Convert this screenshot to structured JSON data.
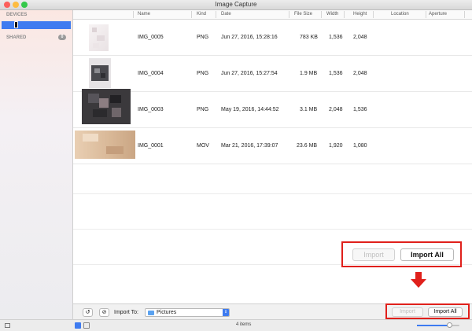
{
  "window": {
    "title": "Image Capture"
  },
  "sidebar": {
    "devices_label": "DEVICES",
    "shared_label": "SHARED",
    "shared_count": "0"
  },
  "columns": [
    "Name",
    "Kind",
    "Date",
    "File Size",
    "Width",
    "Height",
    "Location",
    "Aperture"
  ],
  "files": [
    {
      "name": "IMG_0005",
      "kind": "PNG",
      "date": "Jun 27, 2016, 15:28:16",
      "size": "783 KB",
      "width": "1,536",
      "height": "2,048"
    },
    {
      "name": "IMG_0004",
      "kind": "PNG",
      "date": "Jun 27, 2016, 15:27:54",
      "size": "1.9 MB",
      "width": "1,536",
      "height": "2,048"
    },
    {
      "name": "IMG_0003",
      "kind": "PNG",
      "date": "May 19, 2016, 14:44:52",
      "size": "3.1 MB",
      "width": "2,048",
      "height": "1,536"
    },
    {
      "name": "IMG_0001",
      "kind": "MOV",
      "date": "Mar 21, 2016, 17:39:07",
      "size": "23.6 MB",
      "width": "1,920",
      "height": "1,080"
    }
  ],
  "callout": {
    "import_label": "Import",
    "import_all_label": "Import All"
  },
  "bottom": {
    "import_to_label": "Import To:",
    "destination": "Pictures",
    "import_label": "Import",
    "import_all_label": "Import All"
  },
  "status": {
    "item_count": "4 items",
    "zoom": 0.75
  },
  "colors": {
    "accent": "#3e7bf0",
    "highlight": "#e0201b"
  }
}
